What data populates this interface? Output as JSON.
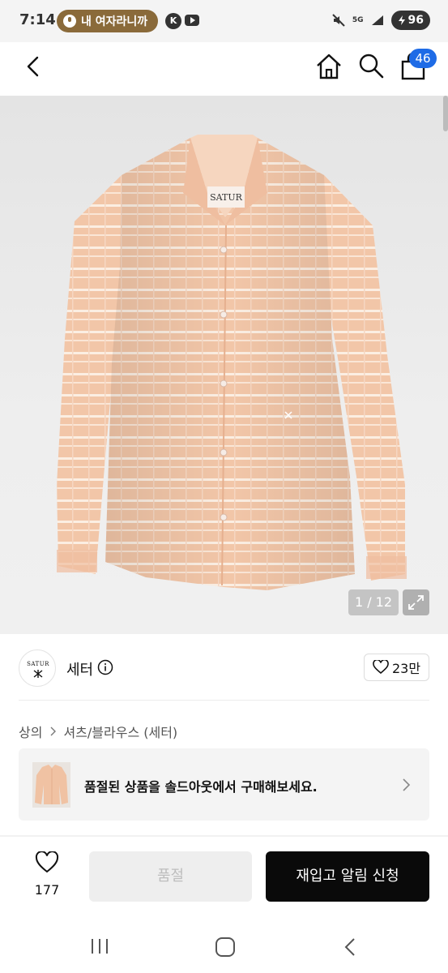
{
  "status_bar": {
    "time": "7:14",
    "notification_text": "내 여자라니까",
    "k_app_glyph": "K",
    "network": "5G",
    "battery": "96"
  },
  "header": {
    "back_icon": "chevron-left-icon",
    "home_icon": "home-icon",
    "search_icon": "search-icon",
    "cart_icon": "shopping-bag-icon",
    "cart_count": "46"
  },
  "gallery": {
    "counter": "1 / 12",
    "expand_icon": "expand-arrows-icon",
    "shirt_label": "SATUR",
    "colors": {
      "shirt": "#f2c6a8",
      "stripe": "#fbeee2",
      "background": "#ececec"
    }
  },
  "brand": {
    "logo_text": "SATUR",
    "name": "세터",
    "likes": "23만"
  },
  "breadcrumb": [
    "상의",
    "셔츠/블라우스 (세터)"
  ],
  "banner": {
    "text": "품절된 상품을 솔드아웃에서 구매해보세요."
  },
  "bottom_bar": {
    "wish_count": "177",
    "soldout_label": "품절",
    "restock_label": "재입고 알림 신청"
  },
  "accent": {
    "badge": "#1e6be6",
    "primary_button": "#0a0a0a"
  }
}
